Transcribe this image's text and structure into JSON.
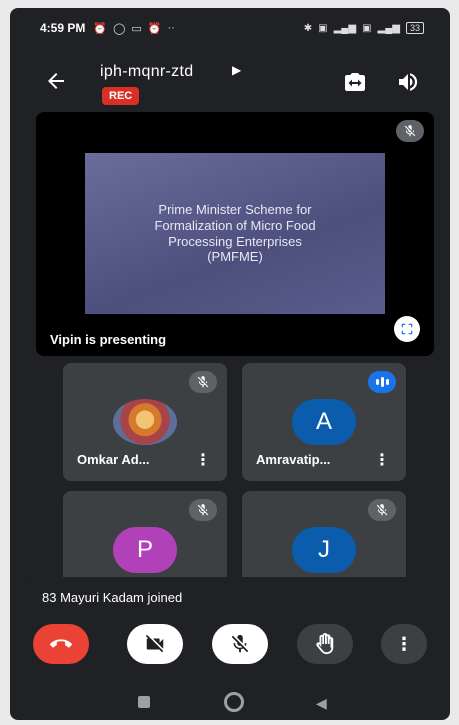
{
  "status_bar": {
    "time": "4:59 PM",
    "notification_icons": [
      "alarm-icon",
      "whatsapp-icon",
      "messages-icon",
      "alarm-icon",
      "more-dots"
    ],
    "right_indicators": [
      "bluetooth-icon",
      "volte-icon",
      "signal-4g-icon",
      "volte-icon",
      "signal-icon"
    ],
    "battery": "33"
  },
  "header": {
    "meeting_code": "iph-mqnr-ztd",
    "recording_badge": "REC"
  },
  "presentation": {
    "slide_text": "Prime Minister Scheme for\nFormalization of Micro Food\nProcessing Enterprises\n(PMFME)",
    "presenter_label": "Vipin is presenting"
  },
  "participants": [
    {
      "name": "Omkar Ad...",
      "avatar_type": "photo",
      "muted": true
    },
    {
      "name": "Amravatip...",
      "avatar_initial": "A",
      "avatar_color": "#0b5cad",
      "speaking": true
    },
    {
      "name": "",
      "avatar_initial": "P",
      "avatar_color": "#b041b8",
      "muted": true
    },
    {
      "name": "",
      "avatar_initial": "J",
      "avatar_color": "#0b5cad",
      "muted": true
    }
  ],
  "toast": "83 Mayuri Kadam joined",
  "colors": {
    "end_call": "#ea4335",
    "background": "#202124",
    "tile": "#3c4043",
    "rec": "#d93025",
    "speaking": "#1a73e8"
  }
}
